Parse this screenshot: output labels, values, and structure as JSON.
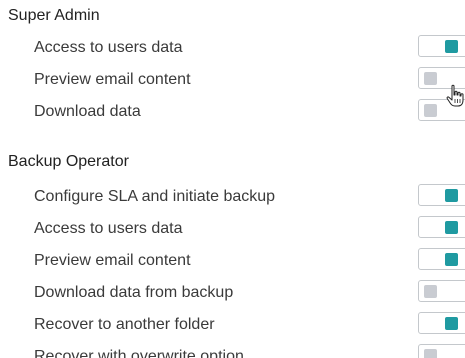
{
  "groups": [
    {
      "title": "Super Admin",
      "permissions": [
        {
          "label": "Access to users data",
          "enabled": true
        },
        {
          "label": "Preview email content",
          "enabled": false
        },
        {
          "label": "Download data",
          "enabled": false
        }
      ]
    },
    {
      "title": "Backup Operator",
      "permissions": [
        {
          "label": "Configure SLA and initiate backup",
          "enabled": true
        },
        {
          "label": "Access to users data",
          "enabled": true
        },
        {
          "label": "Preview email content",
          "enabled": true
        },
        {
          "label": "Download data from backup",
          "enabled": false
        },
        {
          "label": "Recover to another folder",
          "enabled": true
        },
        {
          "label": "Recover with overwrite option",
          "enabled": false
        }
      ]
    }
  ],
  "colors": {
    "toggle_on": "#1f9aa1",
    "toggle_off": "#c9ccd2",
    "toggle_border": "#c4c8cc"
  },
  "cursor_icon": "hand-pointer-icon"
}
